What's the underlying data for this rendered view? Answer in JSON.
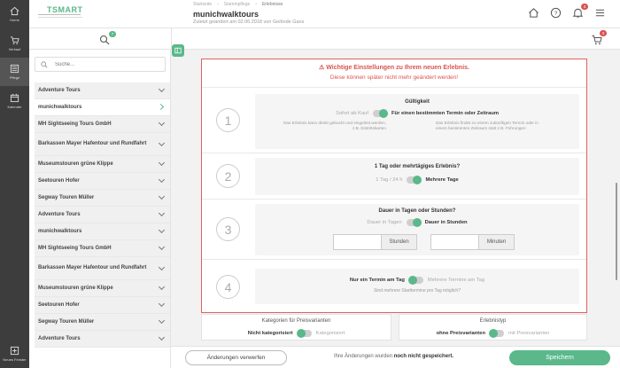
{
  "rail": {
    "items": [
      {
        "label": "Home",
        "icon": "home-icon"
      },
      {
        "label": "Verkauf",
        "icon": "cart-icon"
      },
      {
        "label": "Pflege",
        "icon": "list-icon"
      },
      {
        "label": "Kalender",
        "icon": "calendar-icon"
      },
      {
        "label": "Neues Fenster",
        "icon": "plus-icon"
      }
    ]
  },
  "header": {
    "logo": "TSMART",
    "breadcrumb": [
      "Startseite",
      "Stammpflege",
      "Erlebnisse"
    ],
    "title": "munichwalktours",
    "subtitle": "Zuletzt geändert am 02.06.2018 von Gerlinde Gans",
    "notifications_count": "3"
  },
  "strip": {
    "search_count": "7",
    "cart_count": "3"
  },
  "sidebar": {
    "search_placeholder": "Suche...",
    "items": [
      {
        "label": "Adventure Tours"
      },
      {
        "label": "munichwalktours"
      },
      {
        "label": "MH Sightseeing Tours GmbH"
      },
      {
        "label": "Barkassen Mayer Hafentour und Rundfahrt"
      },
      {
        "label": "Museumstouren grüne Klippe"
      },
      {
        "label": "Seetouren Hofer"
      },
      {
        "label": "Segway Touren Müller"
      },
      {
        "label": "Adventure Tours"
      },
      {
        "label": "munichwalktours"
      },
      {
        "label": "MH Sightseeing Tours GmbH"
      },
      {
        "label": "Barkassen Mayer Hafentour und Rundfahrt"
      },
      {
        "label": "Museumstouren grüne Klippe"
      },
      {
        "label": "Seetouren Hofer"
      },
      {
        "label": "Segway Touren Müller"
      },
      {
        "label": "Adventure Tours"
      }
    ],
    "selected_index": 1
  },
  "warning": {
    "title": "Wichtige Einstellungen zu Ihrem neuen Erlebnis.",
    "text": "Diese können später nicht mehr geändert werden!"
  },
  "steps": {
    "s1": {
      "number": "1",
      "heading": "Gültigkeit",
      "left_label": "Sofort ab Kauf",
      "right_label": "Für einen bestimmten Termin oder Zeitraum",
      "left_desc": "Das Erlebnis kann direkt gebucht und eingelöst werden, z.B. Eintrittskarten",
      "right_desc": "Das Erlebnis findet zu einem zukünftigen Termin oder in einem bestimmten Zeitraum statt z.B. Führungen"
    },
    "s2": {
      "number": "2",
      "heading": "1 Tag oder mehrtägiges Erlebnis?",
      "left_label": "1 Tag / 24 h",
      "right_label": "Mehrere Tage"
    },
    "s3": {
      "number": "3",
      "heading": "Dauer in Tagen oder Stunden?",
      "left_label": "Dauer in Tagen",
      "right_label": "Dauer in Stunden",
      "hours_unit": "Stunden",
      "minutes_unit": "Minuten"
    },
    "s4": {
      "number": "4",
      "left_label": "Nur ein Termin am Tag",
      "right_label": "Mehrere Termine am Tag",
      "hint": "Sind mehrere Starttermine pro Tag möglich?"
    }
  },
  "lower": {
    "categories": {
      "title": "Kategorien für Preisvarianten",
      "left_label": "Nicht kategorisiert",
      "right_label": "Kategorisiert"
    },
    "type": {
      "title": "Erlebnistyp",
      "left_label": "ohne Preisvarianten",
      "right_label": "mit Preisvarianten"
    }
  },
  "footer": {
    "discard_label": "Änderungen verwerfen",
    "message_prefix": "Ihre Änderungen wurden",
    "message_bold": "noch nicht gespeichert.",
    "save_label": "Speichern"
  },
  "colors": {
    "accent": "#5ab88a",
    "warning": "#d9534f",
    "rail": "#3d3d3d"
  }
}
